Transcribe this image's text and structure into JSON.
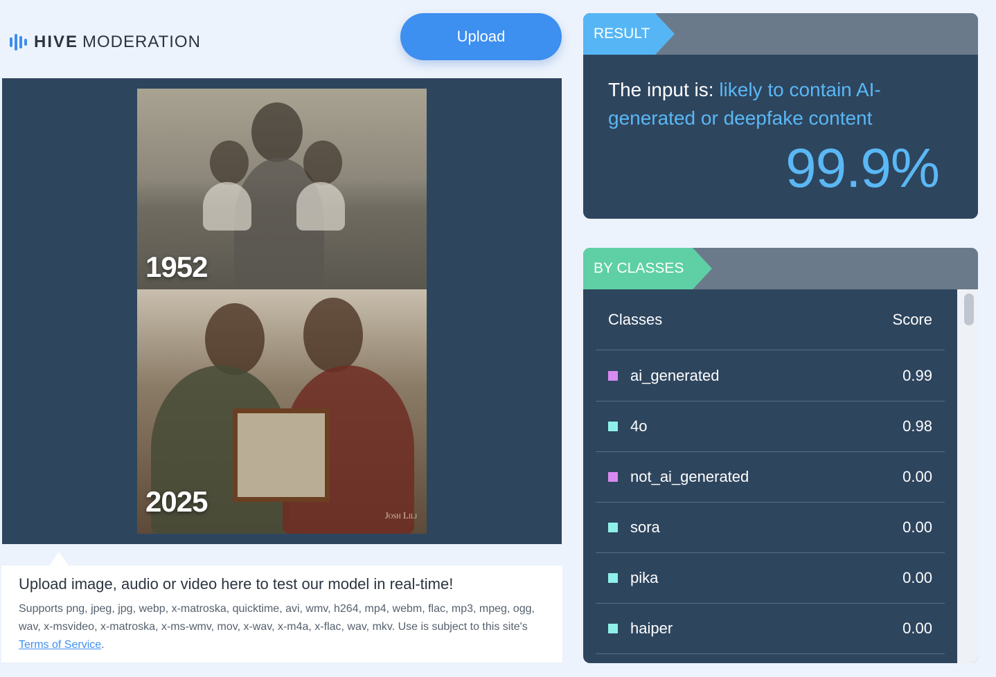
{
  "brand": {
    "bold": "HIVE",
    "light": "MODERATION",
    "accent": "#3c8ef0"
  },
  "upload": {
    "label": "Upload"
  },
  "preview": {
    "year_top": "1952",
    "year_bottom": "2025",
    "signature": "Josh Lilj"
  },
  "info": {
    "title": "Upload image, audio or video here to test our model in real-time!",
    "desc_prefix": "Supports png, jpeg, jpg, webp, x-matroska, quicktime, avi, wmv, h264, mp4, webm, flac, mp3, mpeg, ogg, wav, x-msvideo, x-matroska, x-ms-wmv, mov, x-wav, x-m4a, x-flac, wav, mkv. Use is subject to this site's ",
    "link": "Terms of Service",
    "desc_suffix": "."
  },
  "result": {
    "tag": "RESULT",
    "prefix": "The input is: ",
    "verdict": "likely to contain AI-generated or deepfake content",
    "percent": "99.9%"
  },
  "classes": {
    "tag": "BY CLASSES",
    "col_class": "Classes",
    "col_score": "Score",
    "rows": [
      {
        "name": "ai_generated",
        "score": "0.99",
        "color": "#d98af0"
      },
      {
        "name": "4o",
        "score": "0.98",
        "color": "#8ff0ea"
      },
      {
        "name": "not_ai_generated",
        "score": "0.00",
        "color": "#d98af0"
      },
      {
        "name": "sora",
        "score": "0.00",
        "color": "#8ff0ea"
      },
      {
        "name": "pika",
        "score": "0.00",
        "color": "#8ff0ea"
      },
      {
        "name": "haiper",
        "score": "0.00",
        "color": "#8ff0ea"
      }
    ]
  }
}
